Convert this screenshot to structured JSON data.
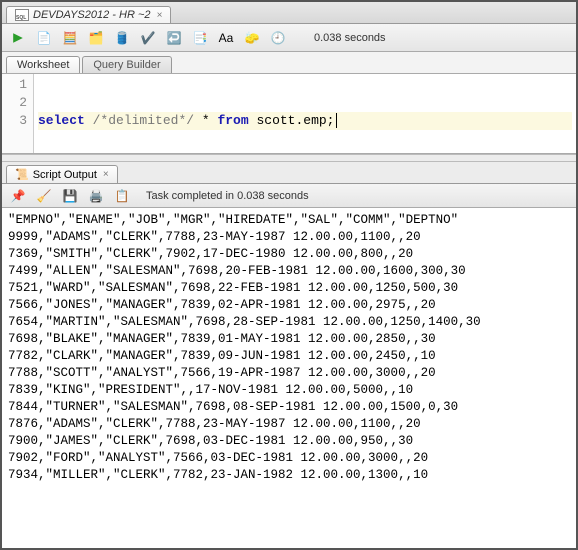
{
  "file_tab": {
    "label": "DEVDAYS2012 - HR ~2"
  },
  "toolbar": {
    "timing": "0.038 seconds"
  },
  "sub_tabs": {
    "worksheet": "Worksheet",
    "query_builder": "Query Builder"
  },
  "gutter": [
    "1",
    "2",
    "3"
  ],
  "code": {
    "kw_select": "select",
    "comment": "/*delimited*/",
    "rest": " * ",
    "kw_from": "from",
    "tail": " scott.emp;"
  },
  "output_tab": {
    "label": "Script Output"
  },
  "output_toolbar": {
    "status": "Task completed in 0.038 seconds"
  },
  "output_lines": [
    "\"EMPNO\",\"ENAME\",\"JOB\",\"MGR\",\"HIREDATE\",\"SAL\",\"COMM\",\"DEPTNO\"",
    "9999,\"ADAMS\",\"CLERK\",7788,23-MAY-1987 12.00.00,1100,,20",
    "7369,\"SMITH\",\"CLERK\",7902,17-DEC-1980 12.00.00,800,,20",
    "7499,\"ALLEN\",\"SALESMAN\",7698,20-FEB-1981 12.00.00,1600,300,30",
    "7521,\"WARD\",\"SALESMAN\",7698,22-FEB-1981 12.00.00,1250,500,30",
    "7566,\"JONES\",\"MANAGER\",7839,02-APR-1981 12.00.00,2975,,20",
    "7654,\"MARTIN\",\"SALESMAN\",7698,28-SEP-1981 12.00.00,1250,1400,30",
    "7698,\"BLAKE\",\"MANAGER\",7839,01-MAY-1981 12.00.00,2850,,30",
    "7782,\"CLARK\",\"MANAGER\",7839,09-JUN-1981 12.00.00,2450,,10",
    "7788,\"SCOTT\",\"ANALYST\",7566,19-APR-1987 12.00.00,3000,,20",
    "7839,\"KING\",\"PRESIDENT\",,17-NOV-1981 12.00.00,5000,,10",
    "7844,\"TURNER\",\"SALESMAN\",7698,08-SEP-1981 12.00.00,1500,0,30",
    "7876,\"ADAMS\",\"CLERK\",7788,23-MAY-1987 12.00.00,1100,,20",
    "7900,\"JAMES\",\"CLERK\",7698,03-DEC-1981 12.00.00,950,,30",
    "7902,\"FORD\",\"ANALYST\",7566,03-DEC-1981 12.00.00,3000,,20",
    "7934,\"MILLER\",\"CLERK\",7782,23-JAN-1982 12.00.00,1300,,10"
  ]
}
